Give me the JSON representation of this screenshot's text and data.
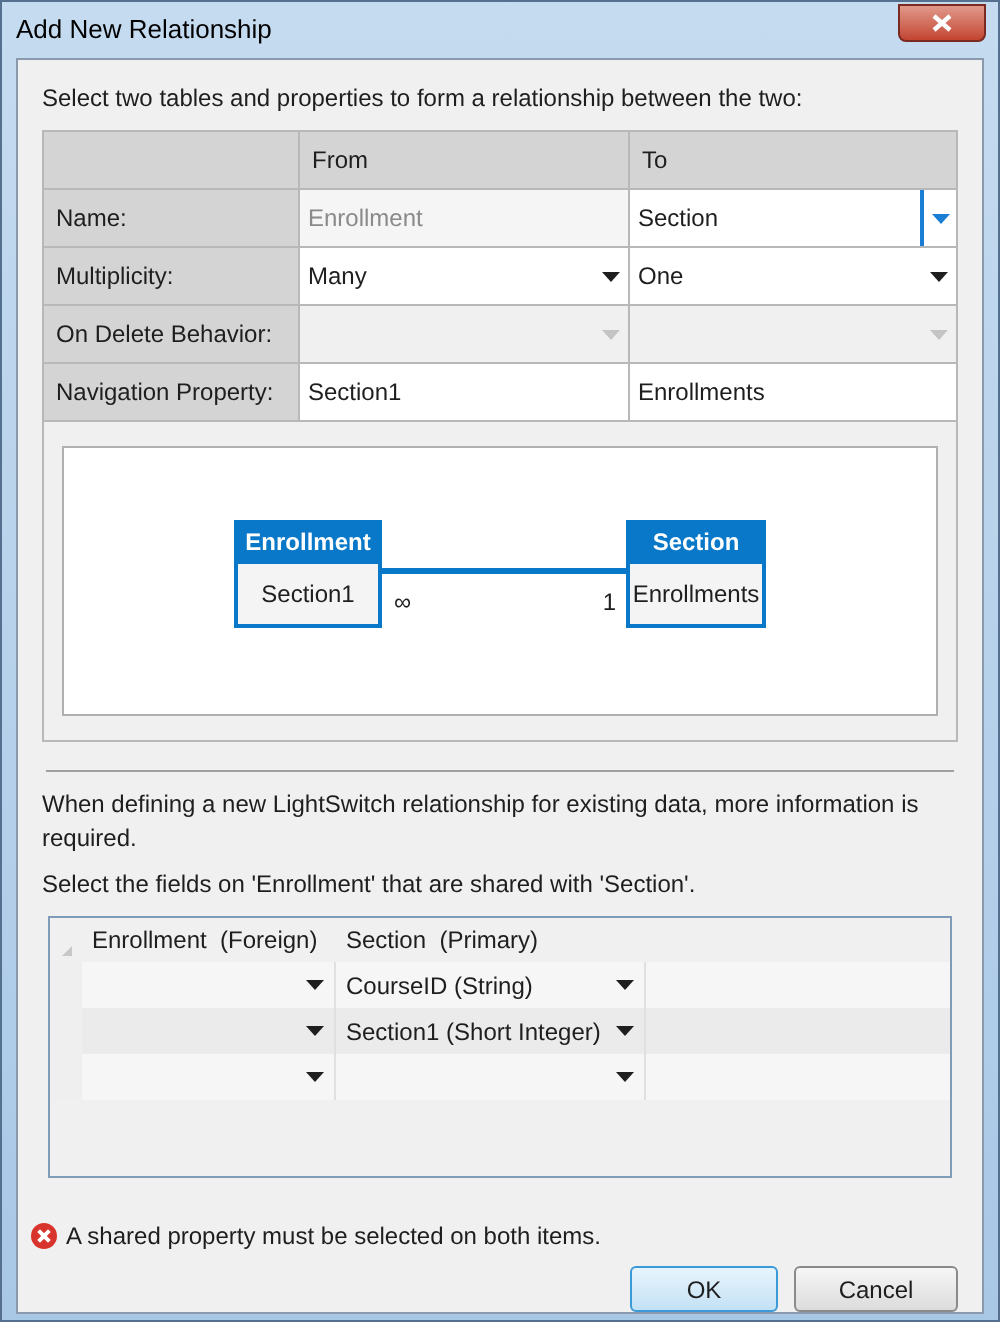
{
  "window": {
    "title": "Add New Relationship"
  },
  "instruction": "Select two tables and properties to form a relationship between the two:",
  "properties": {
    "columns": [
      "From",
      "To"
    ],
    "rows": [
      {
        "label": "Name:",
        "from": {
          "kind": "text",
          "value": "Enrollment",
          "disabled": true
        },
        "to": {
          "kind": "combo",
          "value": "Section",
          "disabled": false,
          "focused": true
        }
      },
      {
        "label": "Multiplicity:",
        "from": {
          "kind": "combo",
          "value": "Many",
          "disabled": false,
          "focused": false
        },
        "to": {
          "kind": "combo",
          "value": "One",
          "disabled": false,
          "focused": false
        }
      },
      {
        "label": "On Delete Behavior:",
        "from": {
          "kind": "combo",
          "disabled": true,
          "focused": false
        },
        "to": {
          "kind": "combo",
          "disabled": true,
          "focused": false
        }
      },
      {
        "label": "Navigation Property:",
        "from": {
          "kind": "text",
          "value": "Section1",
          "disabled": false
        },
        "to": {
          "kind": "text",
          "value": "Enrollments",
          "disabled": false
        }
      }
    ]
  },
  "diagram": {
    "entities": [
      {
        "name": "Enrollment",
        "property": "Section1",
        "multiplicity": "∞"
      },
      {
        "name": "Section",
        "property": "Enrollments",
        "multiplicity": "1"
      }
    ]
  },
  "info": "When defining a new LightSwitch relationship for existing data, more information is required.",
  "fields_prompt": "Select the fields on 'Enrollment' that are shared with 'Section'.",
  "shared_fields": {
    "columns": [
      "Enrollment  (Foreign)",
      "Section  (Primary)"
    ],
    "rows": [
      {
        "primary": "CourseID (String)"
      },
      {
        "primary": "Section1 (Short Integer)"
      },
      {}
    ]
  },
  "error": "A shared property must be selected on both items.",
  "buttons": [
    {
      "label": "OK",
      "default": true
    },
    {
      "label": "Cancel",
      "default": false
    }
  ]
}
